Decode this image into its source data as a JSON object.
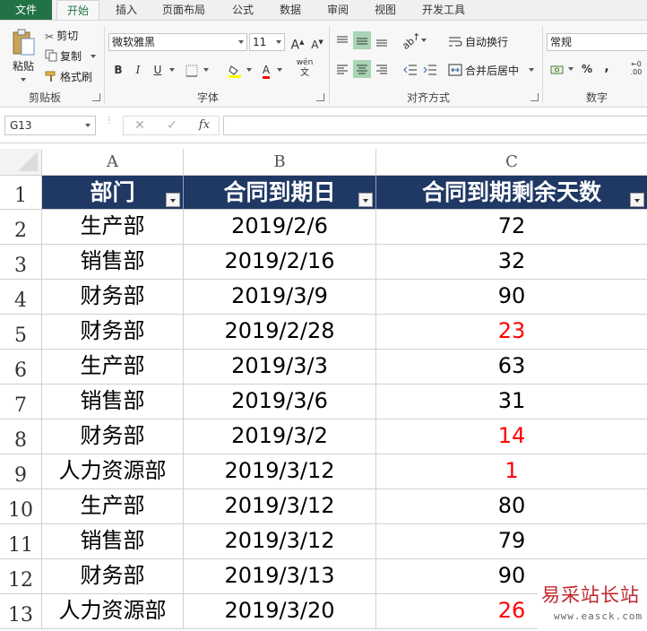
{
  "ribbon_tabs": [
    "文件",
    "开始",
    "插入",
    "页面布局",
    "公式",
    "数据",
    "审阅",
    "视图",
    "开发工具"
  ],
  "clipboard": {
    "paste": "粘贴",
    "cut": "剪切",
    "copy": "复制",
    "format_painter": "格式刷",
    "group_label": "剪贴板"
  },
  "font": {
    "name": "微软雅黑",
    "size": "11",
    "grow": "A",
    "shrink": "A",
    "bold": "B",
    "italic": "I",
    "underline": "U",
    "font_color": "A",
    "phonetic": "wén",
    "group_label": "字体"
  },
  "alignment": {
    "wrap_text": "自动换行",
    "merge_center": "合并后居中",
    "group_label": "对齐方式"
  },
  "number": {
    "format": "常规",
    "percent": "%",
    "comma": ",",
    "group_label": "数字"
  },
  "formula_bar": {
    "name_box": "G13",
    "cancel": "✕",
    "enter": "✓",
    "fx": "fx",
    "content": ""
  },
  "sheet": {
    "columns": [
      "A",
      "B",
      "C"
    ],
    "header": [
      "部门",
      "合同到期日",
      "合同到期剩余天数"
    ],
    "rows": [
      {
        "num": "1"
      },
      {
        "num": "2",
        "dept": "生产部",
        "date": "2019/2/6",
        "days": "72",
        "warn": false
      },
      {
        "num": "3",
        "dept": "销售部",
        "date": "2019/2/16",
        "days": "32",
        "warn": false
      },
      {
        "num": "4",
        "dept": "财务部",
        "date": "2019/3/9",
        "days": "90",
        "warn": false
      },
      {
        "num": "5",
        "dept": "财务部",
        "date": "2019/2/28",
        "days": "23",
        "warn": true
      },
      {
        "num": "6",
        "dept": "生产部",
        "date": "2019/3/3",
        "days": "63",
        "warn": false
      },
      {
        "num": "7",
        "dept": "销售部",
        "date": "2019/3/6",
        "days": "31",
        "warn": false
      },
      {
        "num": "8",
        "dept": "财务部",
        "date": "2019/3/2",
        "days": "14",
        "warn": true
      },
      {
        "num": "9",
        "dept": "人力资源部",
        "date": "2019/3/12",
        "days": "1",
        "warn": true
      },
      {
        "num": "10",
        "dept": "生产部",
        "date": "2019/3/12",
        "days": "80",
        "warn": false
      },
      {
        "num": "11",
        "dept": "销售部",
        "date": "2019/3/12",
        "days": "79",
        "warn": false
      },
      {
        "num": "12",
        "dept": "财务部",
        "date": "2019/3/13",
        "days": "90",
        "warn": false
      },
      {
        "num": "13",
        "dept": "人力资源部",
        "date": "2019/3/20",
        "days": "26",
        "warn": true
      }
    ]
  },
  "colors": {
    "header_fill": "#1f3864",
    "warn_text": "#ff0000",
    "accent": "#217346"
  },
  "watermark": {
    "title": "易采站长站",
    "url": "www.easck.com"
  }
}
